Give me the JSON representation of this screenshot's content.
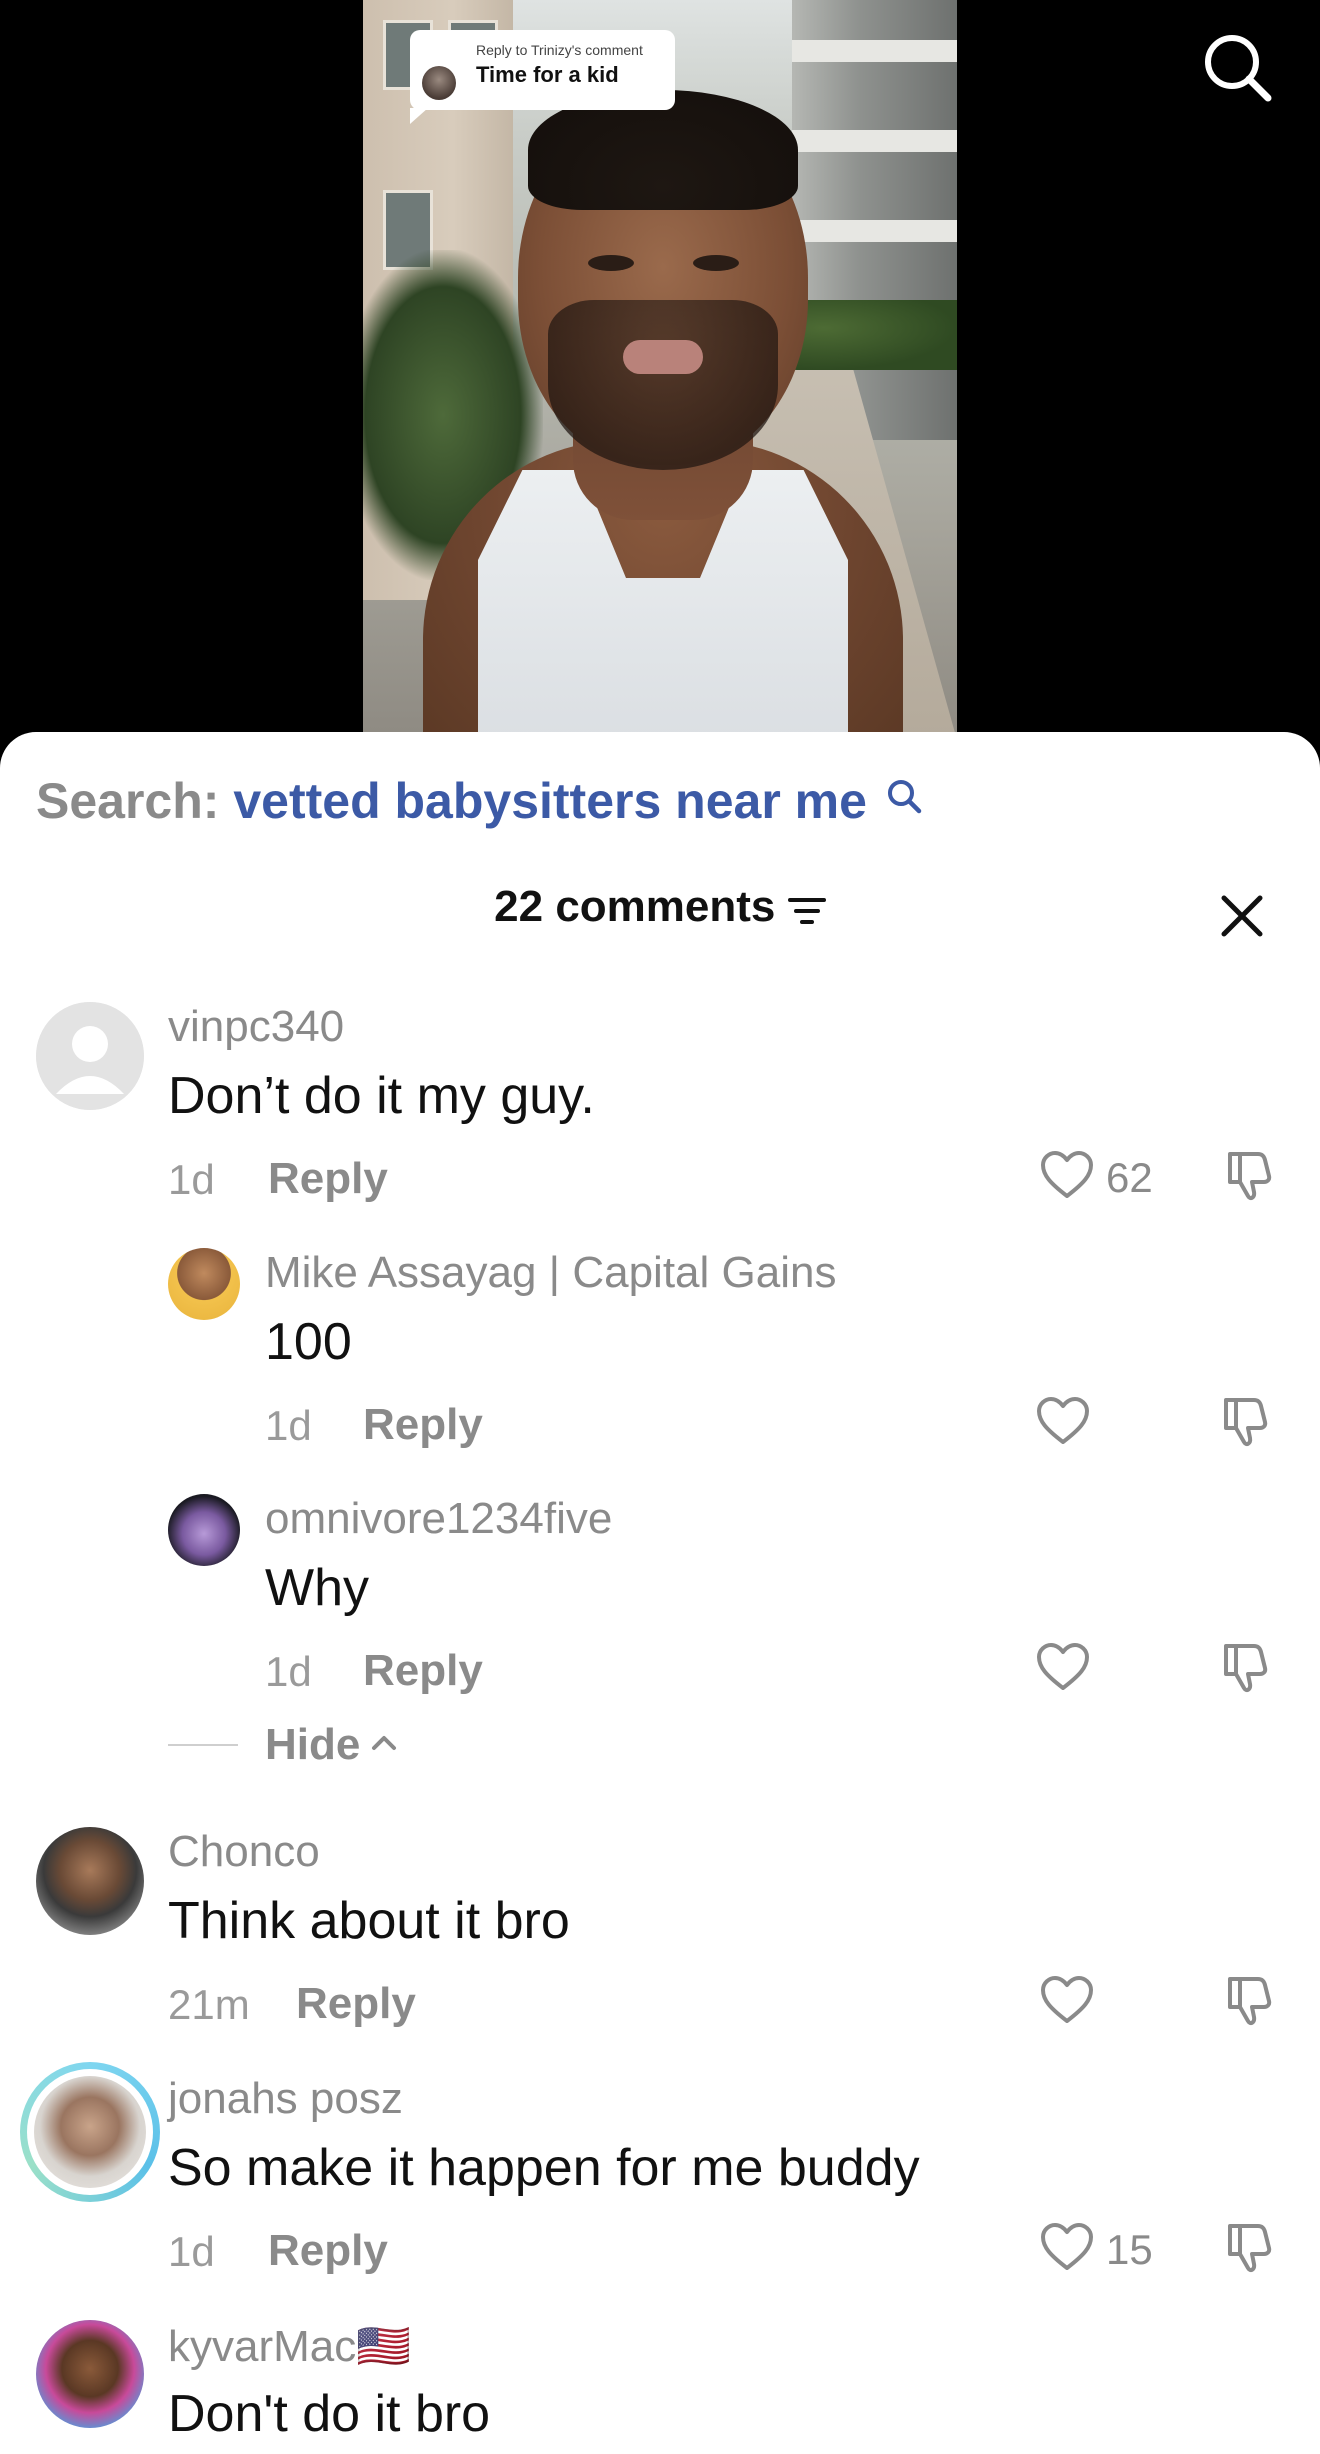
{
  "video": {
    "reply_bubble": {
      "prefix": "Reply to Trinizy's comment",
      "text": "Time for a kid"
    }
  },
  "search": {
    "label": "Search:",
    "term": "vetted babysitters near me"
  },
  "comments_header": {
    "count_label": "22 comments"
  },
  "comments": [
    {
      "username": "vinpc340",
      "text": "Don’t do it my guy.",
      "time": "1d",
      "reply": "Reply",
      "likes": "62"
    },
    {
      "username": "Mike Assayag | Capital Gains",
      "text": "100",
      "time": "1d",
      "reply": "Reply",
      "likes": ""
    },
    {
      "username": "omnivore1234five",
      "text": "Why",
      "time": "1d",
      "reply": "Reply",
      "likes": ""
    },
    {
      "username": "Chonco",
      "text": "Think about it bro",
      "time": "21m",
      "reply": "Reply",
      "likes": ""
    },
    {
      "username": "jonahs posz",
      "text": "So make it happen for me buddy",
      "time": "1d",
      "reply": "Reply",
      "likes": "15"
    },
    {
      "username": "kyvarMac🇺🇸",
      "text": "Don't do it bro",
      "time": "",
      "reply": "",
      "likes": ""
    }
  ],
  "hide": {
    "label": "Hide"
  },
  "colors": {
    "search_term": "#3c5aa6",
    "muted_text": "#8a8a8a",
    "primary_text": "#111111",
    "story_ring": "#5bc0e8"
  },
  "icons": {
    "search": "search-icon",
    "filter": "filter-icon",
    "close": "close-icon",
    "like": "heart-icon",
    "dislike": "thumbs-down-icon",
    "hide_chevron": "chevron-up-icon"
  }
}
